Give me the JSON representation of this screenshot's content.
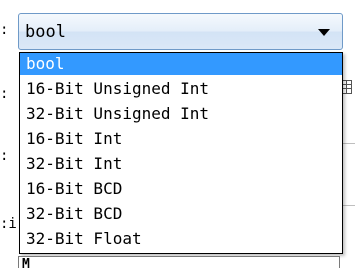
{
  "combobox": {
    "selected_value": "bool"
  },
  "dropdown": {
    "options": [
      {
        "label": "bool",
        "selected": true
      },
      {
        "label": "16-Bit Unsigned Int",
        "selected": false
      },
      {
        "label": "32-Bit Unsigned Int",
        "selected": false
      },
      {
        "label": "16-Bit Int",
        "selected": false
      },
      {
        "label": "32-Bit Int",
        "selected": false
      },
      {
        "label": "16-Bit BCD",
        "selected": false
      },
      {
        "label": "32-Bit BCD",
        "selected": false
      },
      {
        "label": "32-Bit Float",
        "selected": false
      }
    ]
  },
  "background_form": {
    "edge_labels": [
      ":",
      ":",
      ":",
      ":i"
    ],
    "partial_field_text": "M̲"
  },
  "colors": {
    "selection_highlight": "#3399ff",
    "combo_border": "#6f9ac8"
  },
  "icons": {
    "dropdown_arrow": "chevron-down-icon",
    "grid_button": "grid-icon"
  }
}
